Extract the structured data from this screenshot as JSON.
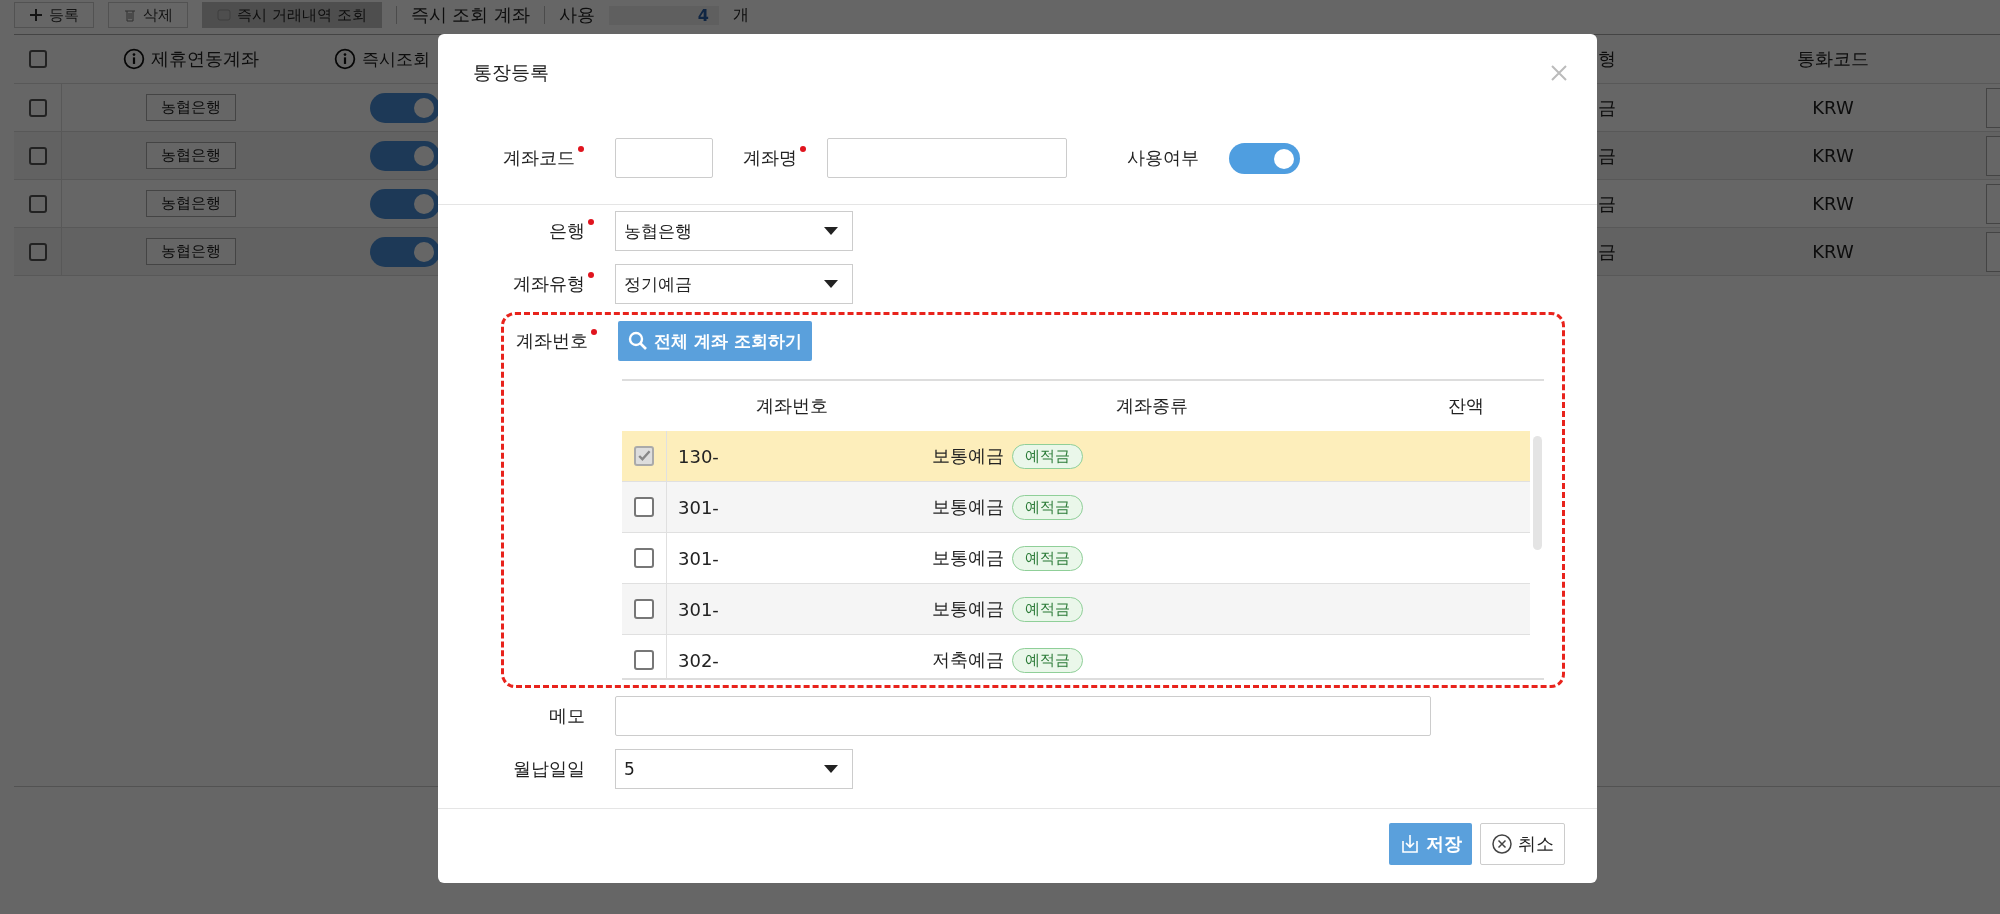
{
  "toolbar": {
    "buttons": [
      {
        "label": "등록",
        "kind": "add",
        "disabled": false
      },
      {
        "label": "삭제",
        "kind": "delete",
        "disabled": false
      },
      {
        "label": "즉시 거래내역 조회",
        "kind": "lookup",
        "disabled": true
      }
    ],
    "summary_label": "즉시 조회 계좌",
    "count_label": "사용",
    "count": "4",
    "unit": "개"
  },
  "accounts_table": {
    "select_all_checked": false,
    "columns": [
      {
        "label": "제휴연동계좌",
        "info": true
      },
      {
        "label": "즉시조회",
        "info": true
      },
      {
        "label": "형",
        "info": false
      },
      {
        "label": "통화코드",
        "info": false
      }
    ],
    "rows": [
      {
        "checked": false,
        "bank": "농협은행",
        "instant": true,
        "column_3": "금",
        "currency": "KRW"
      },
      {
        "checked": false,
        "bank": "농협은행",
        "instant": true,
        "column_3": "금",
        "currency": "KRW"
      },
      {
        "checked": false,
        "bank": "농협은행",
        "instant": true,
        "column_3": "금",
        "currency": "KRW"
      },
      {
        "checked": false,
        "bank": "농협은행",
        "instant": true,
        "column_3": "금",
        "currency": "KRW"
      }
    ]
  },
  "dialog": {
    "title": "통장등록",
    "account_code": {
      "label": "계좌코드",
      "required": true
    },
    "account_name": {
      "label": "계좌명",
      "required": true
    },
    "use": {
      "label": "사용여부",
      "on": true
    },
    "bank": {
      "label": "은행",
      "required": true,
      "value": "농협은행"
    },
    "account_type": {
      "label": "계좌유형",
      "required": true,
      "value": "정기예금"
    },
    "account_number": {
      "label": "계좌번호",
      "required": true,
      "highlighted": true,
      "lookup_button": "전체 계좌 조회하기",
      "columns": [
        "계좌번호",
        "계좌종류",
        "잔액"
      ],
      "rows": [
        {
          "selected": true,
          "checked": true,
          "number": "130-",
          "type": "보통예금",
          "tag": "예적금"
        },
        {
          "selected": false,
          "checked": false,
          "number": "301-",
          "type": "보통예금",
          "tag": "예적금"
        },
        {
          "selected": false,
          "checked": false,
          "number": "301-",
          "type": "보통예금",
          "tag": "예적금"
        },
        {
          "selected": false,
          "checked": false,
          "number": "301-",
          "type": "보통예금",
          "tag": "예적금"
        },
        {
          "selected": false,
          "checked": false,
          "number": "302-",
          "type": "저축예금",
          "tag": "예적금"
        }
      ]
    },
    "memo": {
      "label": "메모",
      "required": false
    },
    "payment_day": {
      "label": "월납일일",
      "required": false,
      "value": "5"
    },
    "buttons": [
      {
        "label": "저장",
        "kind": "save"
      },
      {
        "label": "취소",
        "kind": "cancel"
      }
    ]
  }
}
